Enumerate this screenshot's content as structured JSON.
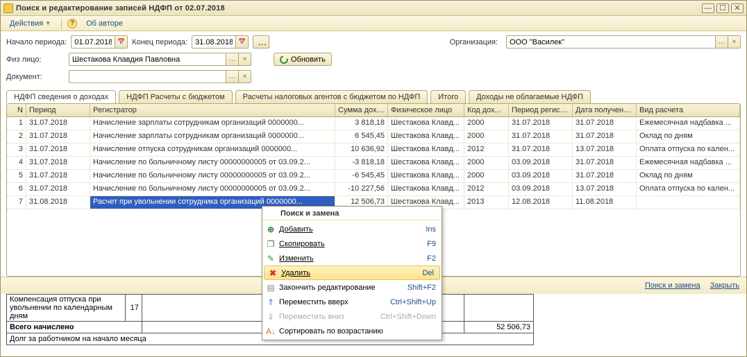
{
  "window": {
    "title": "Поиск и редактирование записей НДФП от 02.07.2018"
  },
  "toolbar": {
    "actions": "Действия",
    "about": "Об авторе"
  },
  "filters": {
    "period_start_label": "Начало периода:",
    "period_start": "01.07.2018",
    "period_end_label": "Конец периода:",
    "period_end": "31.08.2018",
    "org_label": "Организация:",
    "org_value": "ООО \"Василек\"",
    "person_label": "Физ лицо:",
    "person_value": "Шестакова Клавдия Павловна",
    "refresh": "Обновить",
    "doc_label": "Документ:",
    "doc_value": ""
  },
  "tabs": {
    "t1": "НДФП сведения о доходах",
    "t2": "НДФП Расчеты с бюджетом",
    "t3": "Расчеты налоговых агентов с бюджетом по НДФП",
    "t4": "Итого",
    "t5": "Доходы не облагаемые НДФП"
  },
  "grid": {
    "headers": {
      "n": "N",
      "period": "Период",
      "reg": "Регистратор",
      "sum": "Сумма дохо...",
      "phys": "Физическое лицо",
      "code": "Код дох...",
      "preg": "Период регистр...",
      "date": "Дата получени...",
      "kind": "Вид расчета"
    },
    "rows": [
      {
        "n": "1",
        "period": "31.07.2018",
        "reg": "Начисление зарплаты сотрудникам организаций 0000000...",
        "sum": "3 818,18",
        "phys": "Шестакова Клавд...",
        "code": "2000",
        "preg": "31.07.2018",
        "date": "31.07.2018",
        "kind": "Ежемесячная  надбавка ..."
      },
      {
        "n": "2",
        "period": "31.07.2018",
        "reg": "Начисление зарплаты сотрудникам организаций 0000000...",
        "sum": "6 545,45",
        "phys": "Шестакова Клавд...",
        "code": "2000",
        "preg": "31.07.2018",
        "date": "31.07.2018",
        "kind": "Оклад по дням"
      },
      {
        "n": "3",
        "period": "31.07.2018",
        "reg": "Начисление отпуска сотрудникам организаций 0000000...",
        "sum": "10 636,92",
        "phys": "Шестакова Клавд...",
        "code": "2012",
        "preg": "31.07.2018",
        "date": "13.07.2018",
        "kind": "Оплата отпуска по кален..."
      },
      {
        "n": "4",
        "period": "31.07.2018",
        "reg": "Начисление по больничному листу 00000000005 от 03.09.2...",
        "sum": "-3 818,18",
        "phys": "Шестакова Клавд...",
        "code": "2000",
        "preg": "03.09.2018",
        "date": "31.07.2018",
        "kind": "Ежемесячная  надбавка ..."
      },
      {
        "n": "5",
        "period": "31.07.2018",
        "reg": "Начисление по больничному листу 00000000005 от 03.09.2...",
        "sum": "-6 545,45",
        "phys": "Шестакова Клавд...",
        "code": "2000",
        "preg": "03.09.2018",
        "date": "31.07.2018",
        "kind": "Оклад по дням"
      },
      {
        "n": "6",
        "period": "31.07.2018",
        "reg": "Начисление по больничному листу 00000000005 от 03.09.2...",
        "sum": "-10 227,56",
        "phys": "Шестакова Клавд...",
        "code": "2012",
        "preg": "03.09.2018",
        "date": "13.07.2018",
        "kind": "Оплата отпуска по кален..."
      },
      {
        "n": "7",
        "period": "31.08.2018",
        "reg": "Расчет при увольнении сотрудника организаций 0000000...",
        "sum": "12 506,73",
        "phys": "Шестакова Клавд...",
        "code": "2013",
        "preg": "12.08.2018",
        "date": "11.08.2018",
        "kind": ""
      }
    ]
  },
  "context_menu": {
    "title": "Поиск и замена",
    "add": "Добавить",
    "add_sc": "Ins",
    "copy": "Скопировать",
    "copy_sc": "F9",
    "edit": "Изменить",
    "edit_sc": "F2",
    "delete": "Удалить",
    "delete_sc": "Del",
    "finish": "Закончить редактирование",
    "finish_sc": "Shift+F2",
    "moveup": "Переместить вверх",
    "moveup_sc": "Ctrl+Shift+Up",
    "movedown": "Переместить вниз",
    "movedown_sc": "Ctrl+Shift+Down",
    "sort": "Сортировать по возрастанию"
  },
  "footer": {
    "search_replace": "Поиск и замена",
    "close": "Закрыть"
  },
  "bottom": {
    "row1_label": "Компенсация отпуска при увольнении по календарным дням",
    "row1_val": "17",
    "row2_label": "Всего начислено",
    "row2_val": "52 506,73",
    "row3_label": "Долг за работником на начало месяца"
  }
}
